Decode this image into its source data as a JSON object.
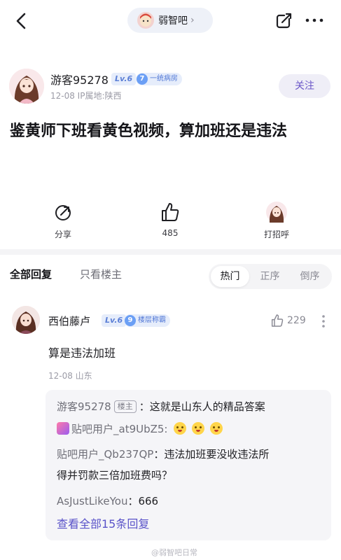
{
  "header": {
    "forum_name": "弱智吧",
    "chevron": "›"
  },
  "post": {
    "author": {
      "name": "游客95278",
      "level": "Lv.6",
      "rank_num": "7",
      "rank_title": "一统病房"
    },
    "meta": "12-08    IP属地:陕西",
    "follow_label": "关注",
    "title": "鉴黄师下班看黄色视频，算加班还是违法"
  },
  "actions": {
    "share_label": "分享",
    "like_count": "485",
    "greet_label": "打招呼"
  },
  "tabs": {
    "all": "全部回复",
    "op_only": "只看楼主"
  },
  "sort": {
    "hot": "热门",
    "asc": "正序",
    "desc": "倒序"
  },
  "comment": {
    "author": "西伯藤卢",
    "level": "Lv.6",
    "rank_num": "9",
    "rank_title": "楼层称霸",
    "likes": "229",
    "text": "算是违法加班",
    "meta": "12-08   山东"
  },
  "replies": [
    {
      "user": "游客95278",
      "tag": "楼主",
      "text": "：这就是山东人的精品答案"
    },
    {
      "user": "贴吧用户_at9UbZ5:"
    },
    {
      "user": "贴吧用户_Qb237QP",
      "text": "：违法加班要没收违法所",
      "text2": "得并罚款三倍加班费吗？"
    },
    {
      "user": "AsJustLikeYou",
      "text": "：666"
    }
  ],
  "view_all": "查看全部15条回复",
  "watermark": "@弱智吧日常",
  "colors": {
    "accent": "#5a53c9",
    "badge_bg": "#e6edfb",
    "text_muted": "#9b9ba6"
  }
}
